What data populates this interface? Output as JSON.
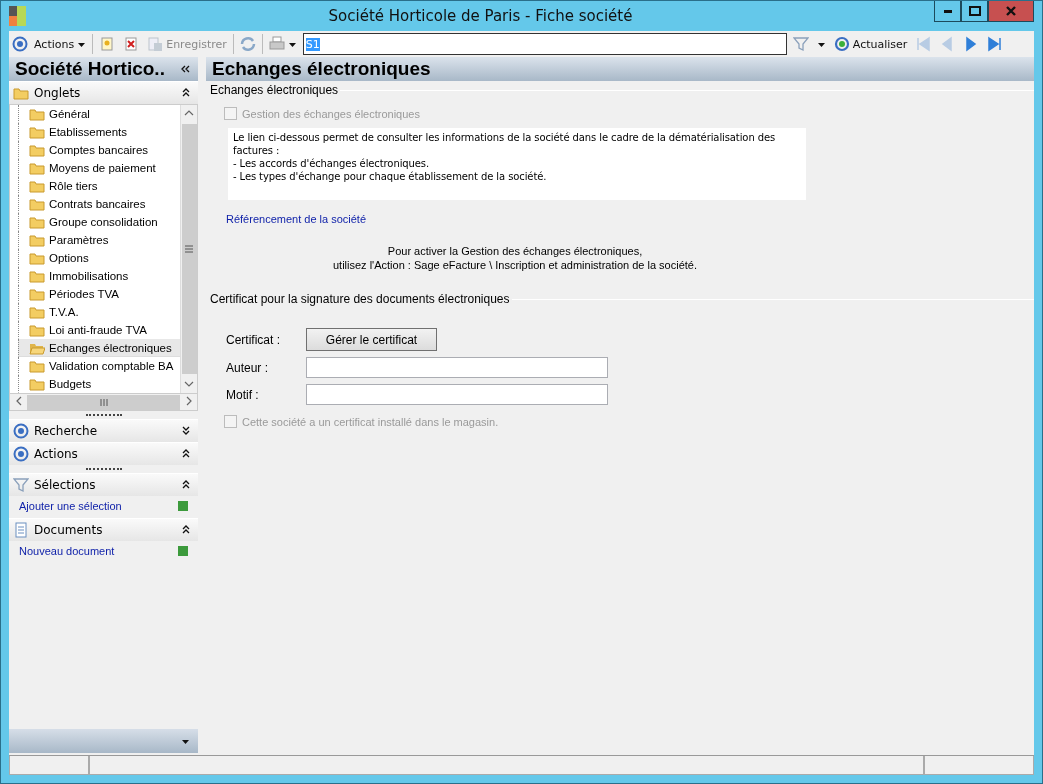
{
  "window": {
    "title": "Société Horticole de Paris -  Fiche société"
  },
  "toolbar": {
    "actions_label": "Actions",
    "save": {
      "label": "Enregistrer",
      "disabled": true
    },
    "search": {
      "value": "S1"
    },
    "refresh_label": "Actualiser",
    "nav": [
      {
        "kind": "first",
        "disabled": true
      },
      {
        "kind": "prev",
        "disabled": true
      },
      {
        "kind": "next",
        "disabled": false
      },
      {
        "kind": "last",
        "disabled": false
      }
    ]
  },
  "sidebar": {
    "title": "Société Hortico..",
    "sections": [
      {
        "kind": "tree",
        "label": "Onglets",
        "expanded": true,
        "items": [
          {
            "label": "Général",
            "selected": false
          },
          {
            "label": "Etablissements",
            "selected": false
          },
          {
            "label": "Comptes bancaires",
            "selected": false
          },
          {
            "label": "Moyens de paiement",
            "selected": false
          },
          {
            "label": "Rôle tiers",
            "selected": false
          },
          {
            "label": "Contrats bancaires",
            "selected": false
          },
          {
            "label": "Groupe consolidation",
            "selected": false
          },
          {
            "label": "Paramètres",
            "selected": false
          },
          {
            "label": "Options",
            "selected": false
          },
          {
            "label": "Immobilisations",
            "selected": false
          },
          {
            "label": "Périodes TVA",
            "selected": false
          },
          {
            "label": "T.V.A.",
            "selected": false
          },
          {
            "label": "Loi anti-fraude TVA",
            "selected": false
          },
          {
            "label": "Echanges électroniques",
            "selected": true
          },
          {
            "label": "Validation comptable BA",
            "selected": false
          },
          {
            "label": "Budgets",
            "selected": false
          }
        ]
      },
      {
        "kind": "target",
        "label": "Recherche",
        "expanded": false
      },
      {
        "kind": "target",
        "label": "Actions",
        "expanded": true
      },
      {
        "kind": "filter",
        "label": "Sélections",
        "expanded": true,
        "link": "Ajouter une sélection"
      },
      {
        "kind": "document",
        "label": "Documents",
        "expanded": true,
        "link": "Nouveau document"
      }
    ]
  },
  "content": {
    "title": "Echanges électroniques",
    "group1": {
      "legend": "Echanges électroniques",
      "checkbox": {
        "label": "Gestion des échanges électroniques",
        "checked": false,
        "disabled": true
      },
      "info_lines": [
        "Le lien ci-dessous permet de consulter les informations de la société dans le cadre de la dématérialisation des factures :",
        "- Les accords d'échanges électroniques.",
        "- Les types d'échange pour chaque établissement de la société."
      ],
      "link": "Référencement de la société",
      "notice_lines": [
        "Pour activer la Gestion des échanges électroniques,",
        "utilisez l'Action : Sage eFacture \\ Inscription et administration de la société."
      ]
    },
    "group2": {
      "legend": "Certificat pour la signature des documents électroniques",
      "certificate_label": "Certificat :",
      "certificate_button": "Gérer le certificat",
      "fields": [
        {
          "label": "Auteur  :"
        },
        {
          "label": "Motif :"
        }
      ],
      "checkbox": {
        "label": "Cette société a un certificat installé dans le magasin.",
        "checked": false,
        "disabled": true
      }
    }
  }
}
